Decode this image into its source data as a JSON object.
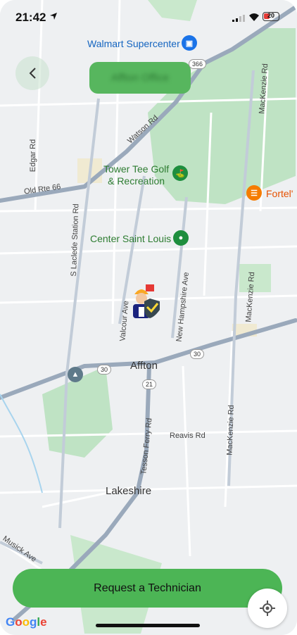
{
  "status_bar": {
    "time": "21:42",
    "battery": "20"
  },
  "destination_pill": {
    "label": "Affton Office"
  },
  "map": {
    "pois": {
      "walmart": "Walmart Supercenter",
      "tower_tee": "Tower Tee Golf\n& Recreation",
      "center_stl": "Center Saint Louis",
      "fortel": "Fortel'"
    },
    "towns": {
      "affton": "Affton",
      "lakeshire": "Lakeshire"
    },
    "roads": {
      "watson": "Watson Rd",
      "old_rte_66": "Old Rte 66",
      "edgar": "Edgar Rd",
      "s_laclede": "S Laclede Station Rd",
      "valcour": "Valcour Ave",
      "new_hampshire": "New Hampshire Ave",
      "mackenzie_1": "MacKenzie Rd",
      "mackenzie_2": "MacKenzie Rd",
      "mackenzie_3": "MacKenzie Rd",
      "tesson_ferry": "Tesson Ferry Rd",
      "reavis": "Reavis Rd",
      "musick": "Musick Ave"
    },
    "shields": {
      "r366": "366",
      "r30a": "30",
      "r30b": "30",
      "r21": "21"
    }
  },
  "request_button": {
    "label": "Request a Technician"
  },
  "attribution": {
    "g1": "G",
    "g2": "o",
    "g3": "o",
    "g4": "g",
    "g5": "l",
    "g6": "e"
  }
}
